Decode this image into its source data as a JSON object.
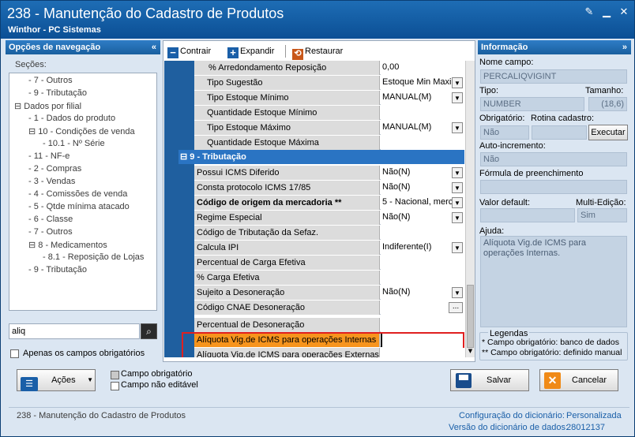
{
  "window": {
    "title": "238 - Manutenção do Cadastro de Produtos",
    "subtitle": "Winthor - PC Sistemas"
  },
  "left_panel": {
    "header": "Opções de navegação",
    "sections_label": "Seções:",
    "tree": [
      {
        "label": "7 - Outros",
        "level": 1,
        "expanded": null
      },
      {
        "label": "9 - Tributação",
        "level": 1,
        "expanded": null
      },
      {
        "label": "Dados por filial",
        "level": 0,
        "expanded": true
      },
      {
        "label": "1 - Dados do produto",
        "level": 1,
        "expanded": null
      },
      {
        "label": "10 - Condições de venda",
        "level": 1,
        "expanded": true
      },
      {
        "label": "10.1 - Nº Série",
        "level": 2,
        "expanded": null
      },
      {
        "label": "11 - NF-e",
        "level": 1,
        "expanded": null
      },
      {
        "label": "2 - Compras",
        "level": 1,
        "expanded": null
      },
      {
        "label": "3 - Vendas",
        "level": 1,
        "expanded": null
      },
      {
        "label": "4 - Comissões de venda",
        "level": 1,
        "expanded": null
      },
      {
        "label": "5 - Qtde mínima atacado",
        "level": 1,
        "expanded": null
      },
      {
        "label": "6 - Classe",
        "level": 1,
        "expanded": null
      },
      {
        "label": "7 - Outros",
        "level": 1,
        "expanded": null
      },
      {
        "label": "8 - Medicamentos",
        "level": 1,
        "expanded": true
      },
      {
        "label": "8.1 - Reposição de Lojas",
        "level": 2,
        "expanded": null
      },
      {
        "label": "9 - Tributação",
        "level": 1,
        "expanded": null
      }
    ],
    "search_value": "aliq",
    "only_required_label": "Apenas os campos obrigatórios"
  },
  "toolbar": {
    "collapse_label": "Contrair",
    "expand_label": "Expandir",
    "restore_label": "Restaurar"
  },
  "grid": {
    "rows_top": [
      {
        "label": "% Arredondamento Reposição",
        "value": "0,00",
        "dropdown": false,
        "bold": false,
        "indent": 2
      },
      {
        "label": "Tipo Sugestão",
        "value": "Estoque Min Maxi",
        "dropdown": true,
        "bold": false,
        "indent": 1
      },
      {
        "label": "Tipo Estoque Mínimo",
        "value": "MANUAL(M)",
        "dropdown": true,
        "bold": false,
        "indent": 1
      },
      {
        "label": "Quantidade Estoque Mínimo",
        "value": "",
        "dropdown": false,
        "bold": false,
        "indent": 1
      },
      {
        "label": "Tipo Estoque Máximo",
        "value": "MANUAL(M)",
        "dropdown": true,
        "bold": false,
        "indent": 1
      },
      {
        "label": "Quantidade Estoque Máxima",
        "value": "",
        "dropdown": false,
        "bold": false,
        "indent": 1
      }
    ],
    "section": "9 - Tributação",
    "rows_section": [
      {
        "label": "Possui ICMS Diferido",
        "value": "Não(N)",
        "dropdown": true,
        "bold": false
      },
      {
        "label": "Consta protocolo ICMS 17/85",
        "value": "Não(N)",
        "dropdown": true,
        "bold": false
      },
      {
        "label": "Código de origem da mercadoria **",
        "value": "5 - Nacional, merc",
        "dropdown": true,
        "bold": true
      },
      {
        "label": "Regime Especial",
        "value": "Não(N)",
        "dropdown": true,
        "bold": false
      },
      {
        "label": "Código de Tributação da Sefaz.",
        "value": "",
        "dropdown": false,
        "bold": false
      },
      {
        "label": "Calcula IPI",
        "value": "Indiferente(I)",
        "dropdown": true,
        "bold": false
      },
      {
        "label": "Percentual de Carga Efetiva",
        "value": "",
        "dropdown": false,
        "bold": false
      },
      {
        "label": "%  Carga Efetiva",
        "value": "",
        "dropdown": false,
        "bold": false
      },
      {
        "label": "Sujeito a Desoneração",
        "value": "Não(N)",
        "dropdown": true,
        "bold": false
      },
      {
        "label": "Código CNAE Desoneração",
        "value": "",
        "dropdown": false,
        "bold": false,
        "ellipsis": "..."
      },
      {
        "label": "Percentual de Desoneração",
        "value": "",
        "dropdown": false,
        "bold": false
      },
      {
        "label": "Alíquota Vig.de ICMS para operações Internas",
        "value": "",
        "dropdown": false,
        "bold": false,
        "selected": true
      },
      {
        "label": "Alíquota Vig.de ICMS para operações Externas",
        "value": "",
        "dropdown": false,
        "bold": false
      }
    ]
  },
  "info_panel": {
    "header": "Informação",
    "field_name_label": "Nome campo:",
    "field_name_value": "PERCALIQVIGINT",
    "type_label": "Tipo:",
    "size_label": "Tamanho:",
    "type_value": "NUMBER",
    "size_value": "(18,6)",
    "required_label": "Obrigatório:",
    "routine_label": "Rotina cadastro:",
    "required_value": "Não",
    "execute_label": "Executar",
    "autoinc_label": "Auto-incremento:",
    "autoinc_value": "Não",
    "formula_label": "Fórmula de preenchimento",
    "default_label": "Valor default:",
    "multi_label": "Multi-Edição:",
    "multi_value": "Sim",
    "help_label": "Ajuda:",
    "help_text": "Alíquota Vig.de ICMS para operações Internas.",
    "legend_title": "Legendas",
    "legend_1": "* Campo obrigatório: banco de dados",
    "legend_2": "** Campo obrigatório: definido manual"
  },
  "bottom": {
    "actions_label": "Ações",
    "legend_required": "Campo obrigatório",
    "legend_readonly": "Campo não editável",
    "save_label": "Salvar",
    "cancel_label": "Cancelar"
  },
  "status": {
    "left_text": "238 - Manutenção do Cadastro de Produtos",
    "dict_config_label": "Configuração do dicionário:",
    "dict_config_value": "Personalizada",
    "dict_version_label": "Versão do dicionário de dados:",
    "dict_version_value": "28012137"
  },
  "colors": {
    "title_bar": "#0b4f95",
    "section_header": "#2a74c3",
    "selected_row": "#f7941d",
    "highlight_border": "#e02020",
    "status_value": "#1a5fa8"
  }
}
